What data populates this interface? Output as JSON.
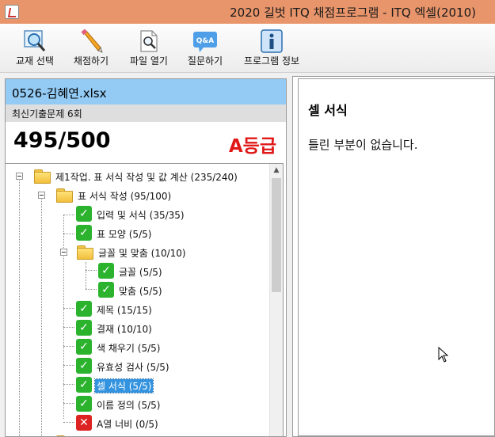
{
  "titlebar": {
    "title": "2020 길벗 ITQ 채점프로그램 - ITQ 엑셀(2010)"
  },
  "toolbar": {
    "items": [
      {
        "label": "교재 선택",
        "icon": "magnifier-icon"
      },
      {
        "label": "채점하기",
        "icon": "pencil-icon"
      },
      {
        "label": "파일 열기",
        "icon": "open-file-icon"
      },
      {
        "label": "질문하기",
        "icon": "qa-icon"
      },
      {
        "label": "프로그램 정보",
        "icon": "info-icon"
      }
    ]
  },
  "summary": {
    "file_name": "0526-김혜연.xlsx",
    "exam_name": "최신기출문제 6회",
    "score": "495/500",
    "grade": "A등급"
  },
  "tree": {
    "nodes": [
      {
        "label": "제1작업. 표 서식 작성 및 값 계산 (235/240)",
        "icon": "folder",
        "level": 0,
        "expander": true
      },
      {
        "label": "표 서식 작성 (95/100)",
        "icon": "folder",
        "level": 1,
        "expander": true
      },
      {
        "label": "입력 및 서식 (35/35)",
        "icon": "check",
        "level": 2
      },
      {
        "label": "표 모양 (5/5)",
        "icon": "check",
        "level": 2
      },
      {
        "label": "글꼴 및 맞춤 (10/10)",
        "icon": "folder",
        "level": 2,
        "expander": true
      },
      {
        "label": "글꼴 (5/5)",
        "icon": "check",
        "level": 3
      },
      {
        "label": "맞춤 (5/5)",
        "icon": "check",
        "level": 3
      },
      {
        "label": "제목 (15/15)",
        "icon": "check",
        "level": 2
      },
      {
        "label": "결재 (10/10)",
        "icon": "check",
        "level": 2
      },
      {
        "label": "색 채우기 (5/5)",
        "icon": "check",
        "level": 2
      },
      {
        "label": "유효성 검사 (5/5)",
        "icon": "check",
        "level": 2
      },
      {
        "label": "셀 서식 (5/5)",
        "icon": "check",
        "level": 2,
        "selected": true
      },
      {
        "label": "이름 정의 (5/5)",
        "icon": "check",
        "level": 2
      },
      {
        "label": "A열 너비 (0/5)",
        "icon": "cross",
        "level": 2
      },
      {
        "label": "",
        "icon": "folder",
        "level": 1
      }
    ]
  },
  "detail": {
    "title": "셀 서식",
    "message": "틀린 부분이 없습니다."
  },
  "colors": {
    "titlebar": "#e9956b",
    "file_row": "#93cbf5",
    "grade": "#e01818",
    "check": "#2bb32e",
    "cross": "#dd2222",
    "selection": "#3393df"
  }
}
